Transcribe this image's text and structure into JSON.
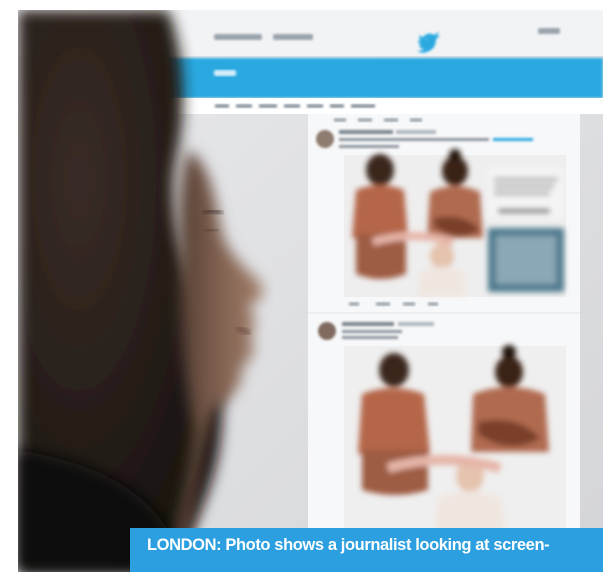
{
  "caption": {
    "text": "LONDON: Photo shows a journalist looking at screen-"
  },
  "photo": {
    "subject": "journalist",
    "screen_app": "twitter-web",
    "brand_color": "#29a9e1",
    "caption_color": "#2b9fe0"
  }
}
